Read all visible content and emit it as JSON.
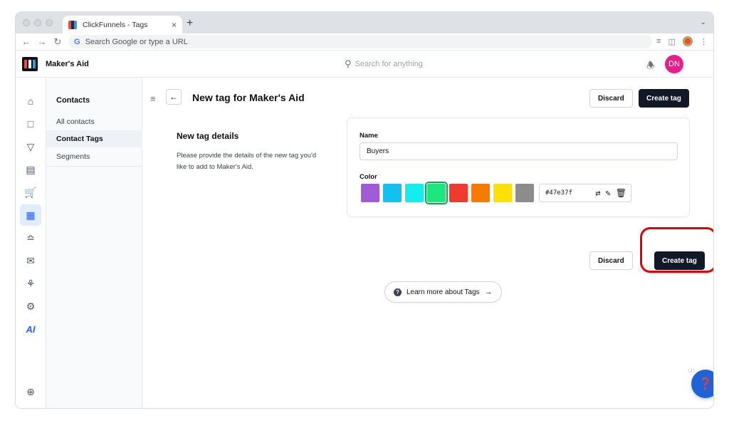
{
  "browser": {
    "tab_title": "ClickFunnels - Tags",
    "tab_close": "×",
    "new_tab": "+",
    "address_placeholder": "Search Google or type a URL",
    "google_g": "G"
  },
  "header": {
    "app_name": "Maker's Aid",
    "search_placeholder": "Search for anything",
    "avatar_initials": "DN"
  },
  "rail": {
    "ai_label": "AI"
  },
  "subnav": {
    "title": "Contacts",
    "items": [
      {
        "label": "All contacts",
        "active": false
      },
      {
        "label": "Contact Tags",
        "active": true
      },
      {
        "label": "Segments",
        "active": false
      }
    ]
  },
  "main": {
    "title": "New tag for Maker's Aid",
    "discard_label": "Discard",
    "create_label": "Create tag",
    "section_title": "New tag details",
    "section_desc": "Please provide the details of the new tag you'd like to add to Maker's Aid.",
    "form": {
      "name_label": "Name",
      "name_value": "Buyers",
      "color_label": "Color",
      "swatches": [
        "#a15bd6",
        "#12c1ec",
        "#12eeee",
        "#1ee67e",
        "#ef3b2e",
        "#f57c00",
        "#fde100",
        "#8c8c8c"
      ],
      "selected_swatch_index": 3,
      "hex_value": "#47e37f"
    },
    "learn_more": "Learn more about Tags",
    "learn_more_arrow": "→",
    "back_arrow": "←"
  },
  "colors": {
    "primary_dark": "#111827",
    "accent_blue": "#2563eb",
    "avatar_pink": "#e91e8c",
    "highlight_red": "#e00000"
  }
}
